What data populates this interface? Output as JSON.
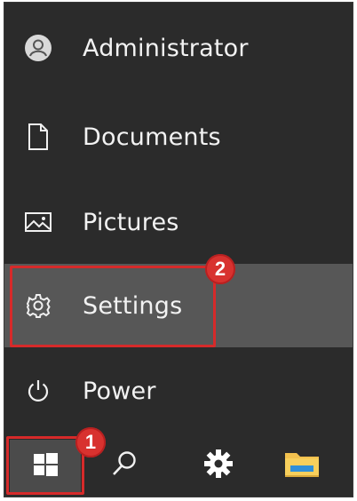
{
  "start_menu": {
    "items": [
      {
        "label": "Administrator",
        "icon": "user-avatar-icon"
      },
      {
        "label": "Documents",
        "icon": "document-icon"
      },
      {
        "label": "Pictures",
        "icon": "pictures-icon"
      },
      {
        "label": "Settings",
        "icon": "gear-icon"
      },
      {
        "label": "Power",
        "icon": "power-icon"
      }
    ]
  },
  "taskbar": {
    "items": [
      {
        "icon": "windows-logo-icon"
      },
      {
        "icon": "search-icon"
      },
      {
        "icon": "settings-gear-icon"
      },
      {
        "icon": "file-explorer-icon"
      }
    ]
  },
  "callouts": [
    {
      "number": "1",
      "target": "Start button"
    },
    {
      "number": "2",
      "target": "Settings"
    }
  ],
  "colors": {
    "menu_bg": "#2b2b2b",
    "highlight_bg": "#575757",
    "callout_red": "#d62a2a",
    "text": "#f2f2f2"
  }
}
